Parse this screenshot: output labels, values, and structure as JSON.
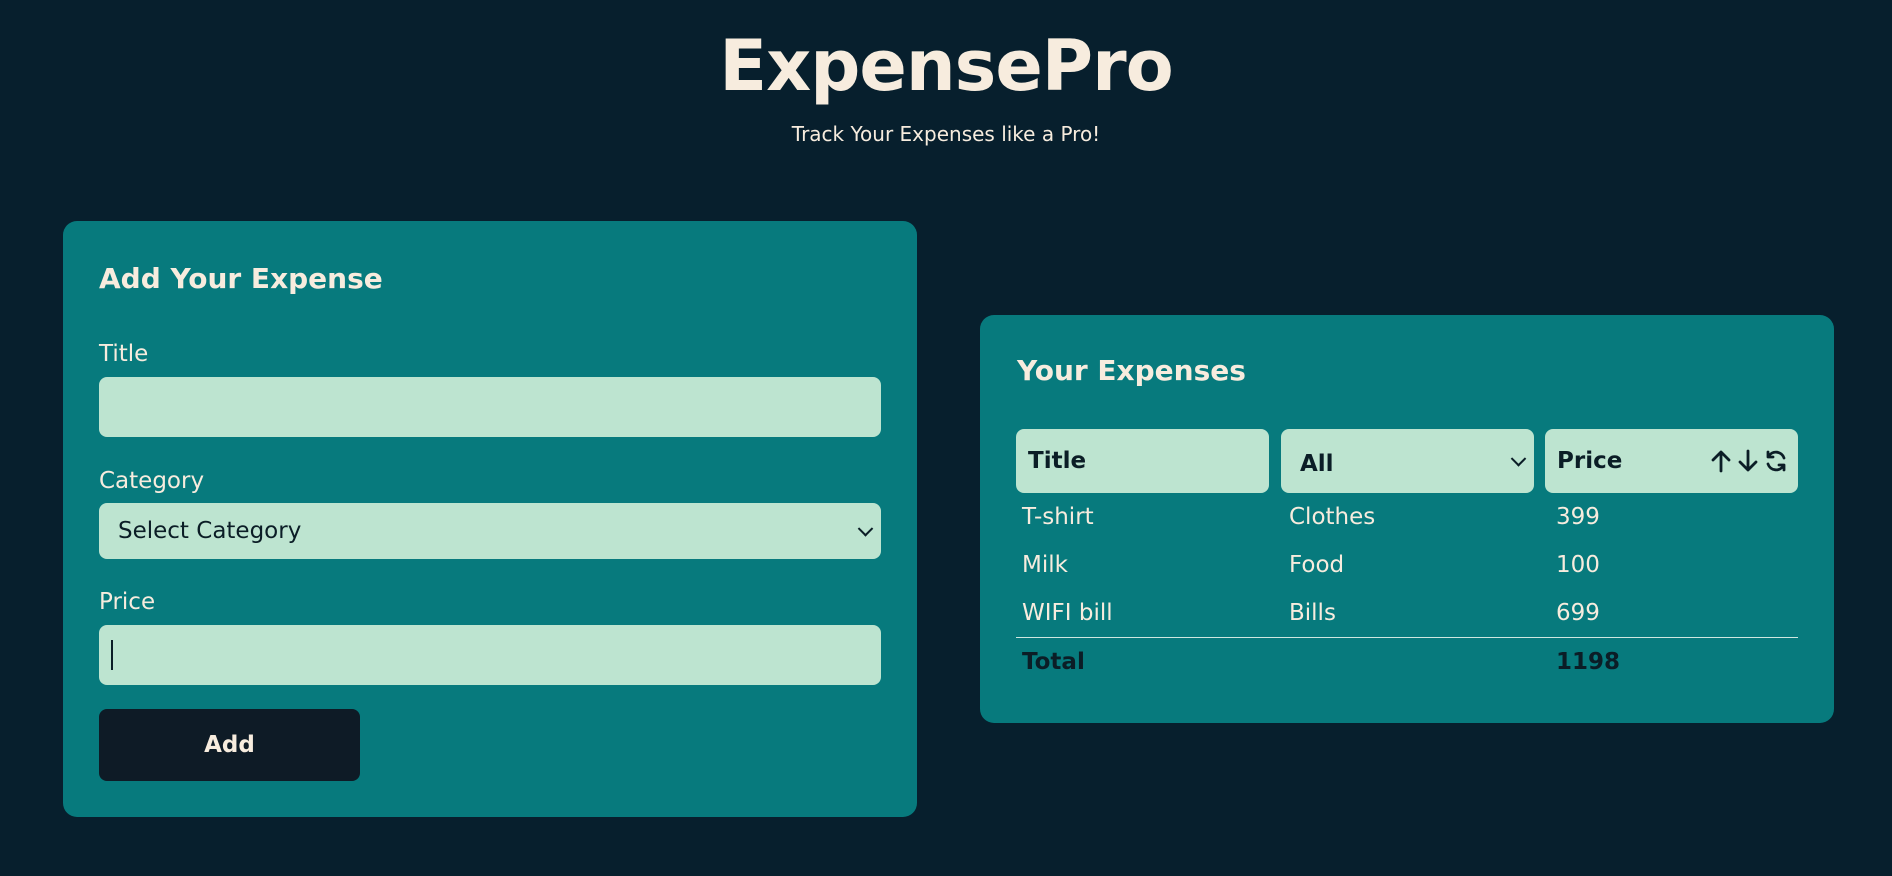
{
  "app": {
    "title": "ExpensePro",
    "subtitle": "Track Your Expenses like a Pro!"
  },
  "add_form": {
    "heading": "Add Your Expense",
    "title_label": "Title",
    "title_value": "",
    "category_label": "Category",
    "category_selected": "Select Category",
    "price_label": "Price",
    "price_value": "",
    "add_label": "Add"
  },
  "expenses": {
    "heading": "Your Expenses",
    "columns": {
      "title": "Title",
      "category_filter": "All",
      "price": "Price"
    },
    "rows": [
      {
        "title": "T-shirt",
        "category": "Clothes",
        "price": "399"
      },
      {
        "title": "Milk",
        "category": "Food",
        "price": "100"
      },
      {
        "title": "WIFI bill",
        "category": "Bills",
        "price": "699"
      }
    ],
    "total_label": "Total",
    "total_value": "1198"
  },
  "icons": {
    "sort_asc": "arrow-up-icon",
    "sort_desc": "arrow-down-icon",
    "clear_sort": "refresh-icon"
  },
  "colors": {
    "background": "#071f2d",
    "card": "#077a7d",
    "field": "#bde4d0",
    "text_light": "#f7ecde",
    "button": "#0e1b26"
  }
}
